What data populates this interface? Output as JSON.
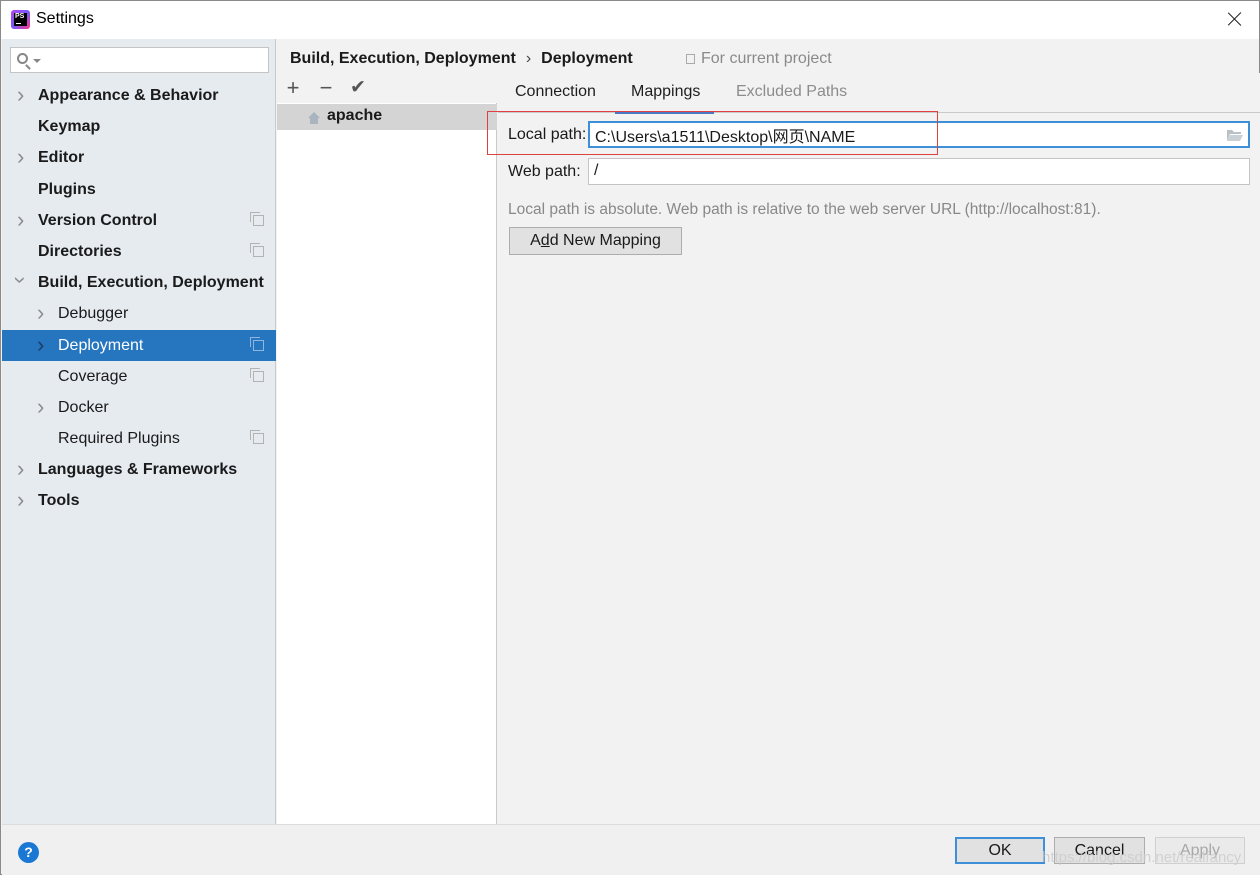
{
  "window": {
    "title": "Settings",
    "app_icon": "phpstorm-icon",
    "app_icon_text": "PS"
  },
  "search": {
    "placeholder": "",
    "value": ""
  },
  "sidebar": {
    "items": [
      {
        "label": "Appearance & Behavior",
        "level": 0,
        "chevron": "right",
        "project_icon": false
      },
      {
        "label": "Keymap",
        "level": 0,
        "chevron": "none",
        "project_icon": false
      },
      {
        "label": "Editor",
        "level": 0,
        "chevron": "right",
        "project_icon": false
      },
      {
        "label": "Plugins",
        "level": 0,
        "chevron": "none",
        "project_icon": false
      },
      {
        "label": "Version Control",
        "level": 0,
        "chevron": "right",
        "project_icon": true
      },
      {
        "label": "Directories",
        "level": 0,
        "chevron": "none",
        "project_icon": true
      },
      {
        "label": "Build, Execution, Deployment",
        "level": 0,
        "chevron": "down",
        "project_icon": false
      },
      {
        "label": "Debugger",
        "level": 1,
        "chevron": "right",
        "project_icon": false
      },
      {
        "label": "Deployment",
        "level": 1,
        "chevron": "right",
        "project_icon": true,
        "selected": true
      },
      {
        "label": "Coverage",
        "level": 1,
        "chevron": "none",
        "project_icon": true
      },
      {
        "label": "Docker",
        "level": 1,
        "chevron": "right",
        "project_icon": false
      },
      {
        "label": "Required Plugins",
        "level": 1,
        "chevron": "none",
        "project_icon": true
      },
      {
        "label": "Languages & Frameworks",
        "level": 0,
        "chevron": "right",
        "project_icon": false
      },
      {
        "label": "Tools",
        "level": 0,
        "chevron": "right",
        "project_icon": false
      }
    ]
  },
  "breadcrumb": {
    "parent": "Build, Execution, Deployment",
    "separator": "›",
    "current": "Deployment",
    "scope": "For current project"
  },
  "servers": {
    "toolbar": {
      "add": "+",
      "remove": "−",
      "default": "✔"
    },
    "items": [
      {
        "name": "apache",
        "icon": "home-icon"
      }
    ]
  },
  "tabs": [
    {
      "label": "Connection",
      "state": "normal"
    },
    {
      "label": "Mappings",
      "state": "active"
    },
    {
      "label": "Excluded Paths",
      "state": "disabled"
    }
  ],
  "mappings": {
    "local_path_label": "Local path:",
    "local_path_value": "C:\\Users\\a1511\\Desktop\\网页\\NAME",
    "web_path_label": "Web path:",
    "web_path_value": "/",
    "hint": "Local path is absolute. Web path is relative to the web server URL (http://localhost:81).",
    "add_button_prefix": "A",
    "add_button_mnemonic": "d",
    "add_button_suffix": "d New Mapping"
  },
  "footer": {
    "help": "?",
    "ok": "OK",
    "cancel": "Cancel",
    "apply": "Apply",
    "watermark": "https://blog.csdn.net/realfancy"
  },
  "colors": {
    "selection": "#2675bf",
    "focus_border": "#3d8fd8",
    "tab_underline": "#4a78c2",
    "annotation_box": "#e04040",
    "sidebar_bg": "#e6ebf0"
  }
}
